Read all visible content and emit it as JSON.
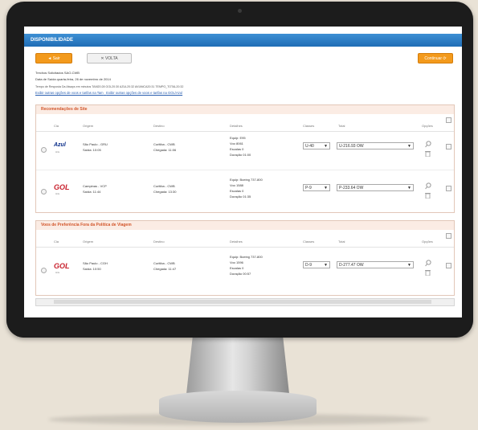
{
  "header": {
    "title": "DISPONIBILIDADE"
  },
  "buttons": {
    "back_label": "◄ Sair",
    "volta_label": "✕ VOLTA",
    "refresh_label": "Continuar ⟳"
  },
  "trip_info": {
    "line1": "Trechos Solicitados SAO-CWB",
    "line2": "Data de Saída quarta-feira, 26 de novembro de 2014",
    "line3": "Tempo de Resposta Da Always em minutos TAM20:28 GOL20:30 AZUL20:32 AVIANCA20:31 TEMPO_TOTAL20:32",
    "link1": "Exibir outras opções de voos e tarifas na Tam",
    "link2": "Exibir outras opções de voos e tarifas na GOL/Azul"
  },
  "columns": {
    "cia": "Cia",
    "origem": "Origem",
    "destino": "Destino",
    "detalhes": "Detalhes",
    "classes": "Classes",
    "total": "Total",
    "opcoes": "Opções"
  },
  "sections": [
    {
      "title": "Recomendações de Site",
      "flights": [
        {
          "airline_logo": "Azul",
          "airline_sub": "Hits",
          "origem": "São Paulo - GRU",
          "saida": "Saída: 10:05",
          "destino": "Curitiba - CWB",
          "chegada": "Chegada: 11:06",
          "details": [
            "Equip: E95",
            "Voo 8061",
            "Escalas 0",
            "Duração 01:00"
          ],
          "classe": "U-40",
          "total": "U-216.93 OW"
        },
        {
          "airline_logo": "GOL",
          "airline_sub": "Hits",
          "origem": "Campinas - VCP",
          "saida": "Saída: 11:44",
          "destino": "Curitiba - CWB",
          "chegada": "Chegada: 13:30",
          "details": [
            "Equip: Boeing 737-800",
            "Voo 1588",
            "Escalas 0",
            "Duração 01:35"
          ],
          "classe": "P-9",
          "total": "P-233.64 OW"
        }
      ]
    },
    {
      "title": "Voos de Preferência Fora da Política de Viagem",
      "flights": [
        {
          "airline_logo": "GOL",
          "airline_sub": "Hits",
          "origem": "São Paulo - CGH",
          "saida": "Saída: 10:50",
          "destino": "Curitiba - CWB",
          "chegada": "Chegada: 11:47",
          "details": [
            "Equip: Boeing 737-800",
            "Voo 1596",
            "Escalas 0",
            "Duração 00:57"
          ],
          "classe": "D-9",
          "total": "D-277.47 OW"
        }
      ]
    }
  ],
  "icons": {
    "search": "magnifier-icon",
    "trash": "trash-icon"
  },
  "colors": {
    "header_blue": "#1f6db5",
    "accent_orange": "#f39a1c",
    "section_red": "#d2552a",
    "azul_blue": "#0b2e8a",
    "gol_red": "#c8202c"
  }
}
